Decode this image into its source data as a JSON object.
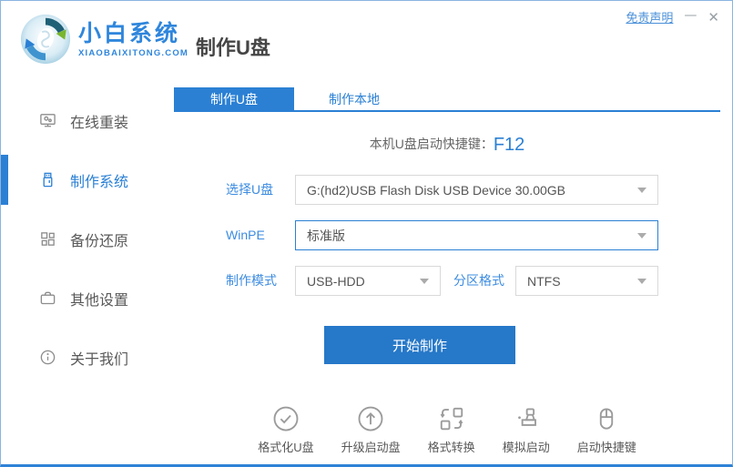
{
  "window": {
    "disclaimer_link": "免责声明",
    "minimize": "—",
    "close": "✕"
  },
  "brand": {
    "name": "小白系统",
    "domain": "XIAOBAIXITONG.COM",
    "page_title": "制作U盘"
  },
  "sidebar": {
    "items": [
      {
        "label": "在线重装",
        "icon": "monitor-icon",
        "active": false
      },
      {
        "label": "制作系统",
        "icon": "usb-drive-icon",
        "active": true
      },
      {
        "label": "备份还原",
        "icon": "grid-blocks-icon",
        "active": false
      },
      {
        "label": "其他设置",
        "icon": "briefcase-icon",
        "active": false
      },
      {
        "label": "关于我们",
        "icon": "info-circle-icon",
        "active": false
      }
    ]
  },
  "tabs": [
    {
      "label": "制作U盘",
      "active": true
    },
    {
      "label": "制作本地",
      "active": false
    }
  ],
  "main": {
    "hotkey_label": "本机U盘启动快捷键：",
    "hotkey_value": "F12",
    "form": {
      "usb_label": "选择U盘",
      "usb_value": "G:(hd2)USB Flash Disk USB Device 30.00GB",
      "winpe_label": "WinPE",
      "winpe_value": "标准版",
      "mode_label": "制作模式",
      "mode_value": "USB-HDD",
      "partition_label": "分区格式",
      "partition_value": "NTFS"
    },
    "start_button": "开始制作"
  },
  "footer_tools": [
    {
      "label": "格式化U盘",
      "icon": "check-circle-icon"
    },
    {
      "label": "升级启动盘",
      "icon": "upgrade-arrow-circle-icon"
    },
    {
      "label": "格式转换",
      "icon": "format-convert-icon"
    },
    {
      "label": "模拟启动",
      "icon": "stamp-icon"
    },
    {
      "label": "启动快捷键",
      "icon": "mouse-icon"
    }
  ],
  "colors": {
    "primary_blue": "#2b80d4",
    "button_blue": "#2678c8",
    "label_blue": "#3d8ce0",
    "border_gray": "#d9d9d9",
    "text_gray": "#595959",
    "icon_gray": "#9b9b9b"
  }
}
